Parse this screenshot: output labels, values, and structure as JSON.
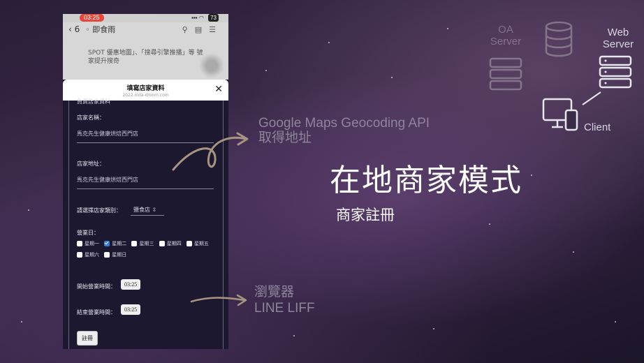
{
  "phone": {
    "status_time": "03:25",
    "battery": "73",
    "chat_back_count": "6",
    "chat_title": "即食雨",
    "bg_message": "SPOT 優惠地圖」、「搜尋引擎推播」等 號家提升搜奇",
    "sheet_title": "填寫店家資料",
    "sheet_url": "2022.nida-droom.com"
  },
  "form": {
    "section_cut": "負責店家資料",
    "store_name_label": "店家名稱：",
    "store_name_value": "馬克先生健康烘焙西門店",
    "store_address_label": "店家地址：",
    "store_address_value": "馬克先生健康烘焙西門店",
    "category_label": "請選擇店家類別：",
    "category_value": "鹽食店",
    "business_days_label": "營業日：",
    "days": [
      {
        "label": "星期一",
        "checked": false
      },
      {
        "label": "星期二",
        "checked": true
      },
      {
        "label": "星期三",
        "checked": false
      },
      {
        "label": "星期四",
        "checked": false
      },
      {
        "label": "星期五",
        "checked": false
      },
      {
        "label": "星期六",
        "checked": false
      },
      {
        "label": "星期日",
        "checked": false
      }
    ],
    "open_time_label": "開始營業時間：",
    "open_time_value": "03:25",
    "close_time_label": "結束營業時間：",
    "close_time_value": "03:25",
    "submit_label": "註冊"
  },
  "annotations": {
    "api_line1": "Google Maps Geocoding API",
    "api_line2": "取得地址",
    "browser_line1": "瀏覽器",
    "browser_line2": "LINE LIFF"
  },
  "slide": {
    "title": "在地商家模式",
    "subtitle": "商家註冊"
  },
  "diagram": {
    "oa_server": "OA Server",
    "web_server": "Web Server",
    "client": "Client"
  }
}
